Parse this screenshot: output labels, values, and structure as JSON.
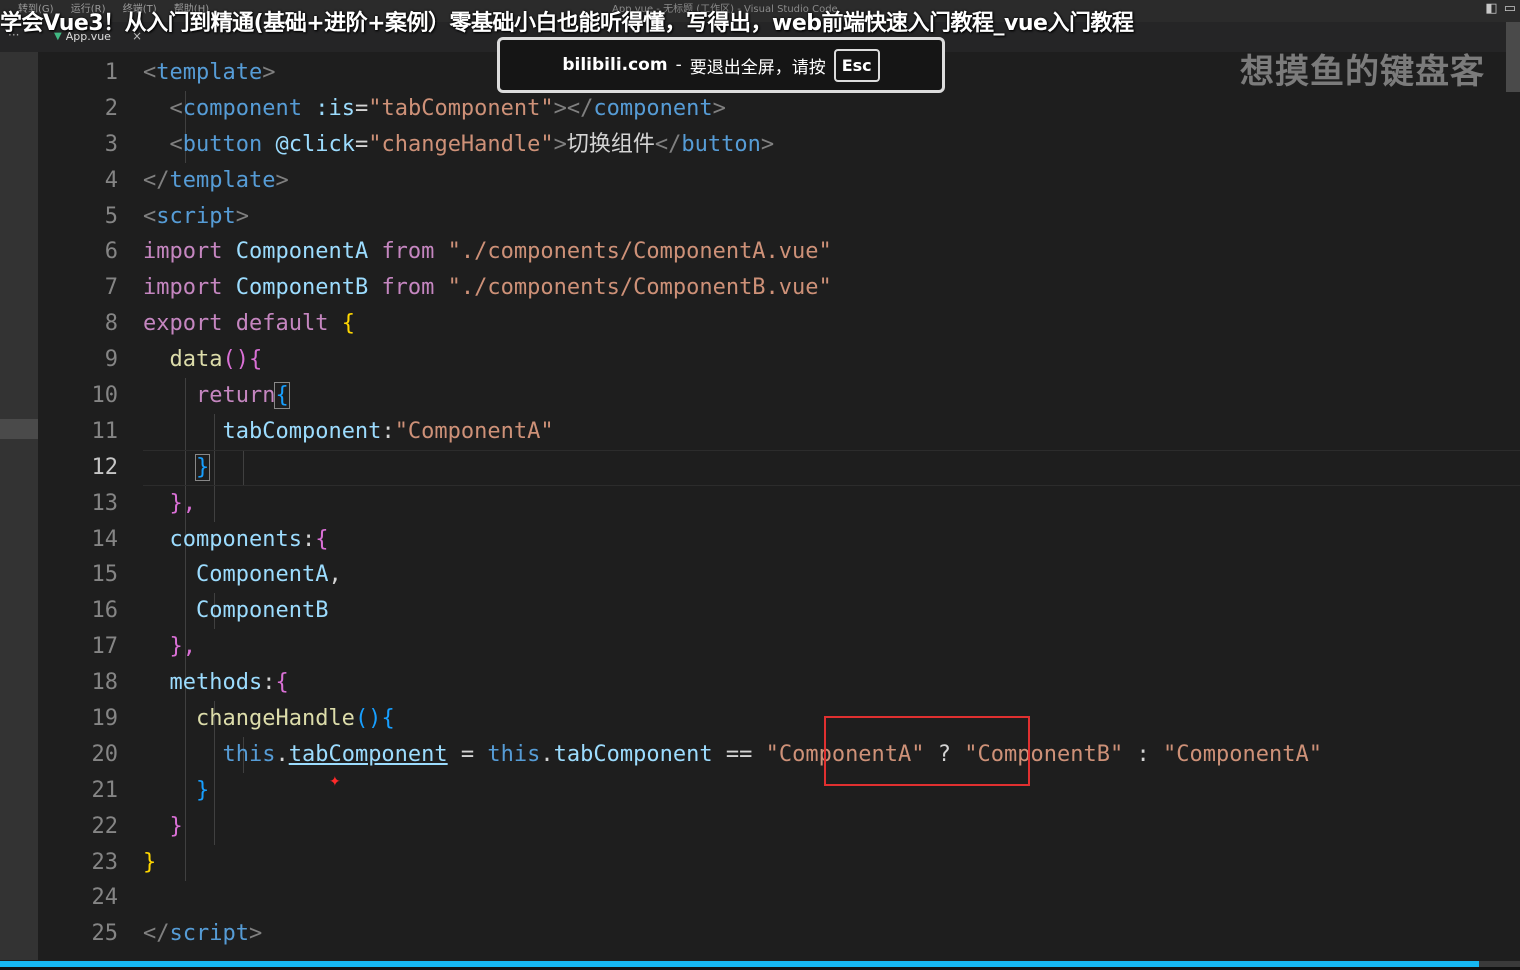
{
  "menu": [
    "转到(G)",
    "运行(R)",
    "终端(T)",
    "帮助(H)"
  ],
  "window_title": "App.vue - 无标题 (工作区) - Visual Studio Code",
  "video_title": "学会Vue3！从入门到精通(基础+进阶+案例）零基础小白也能听得懂，写得出，web前端快速入门教程_vue入门教程",
  "tab": {
    "ellipsis": "···",
    "label": "App.vue",
    "close": "×"
  },
  "fullscreen_notice": {
    "domain": "bilibili.com",
    "dash": "-",
    "message": "要退出全屏，请按",
    "key": "Esc"
  },
  "watermark": "想摸鱼的键盘客",
  "editor": {
    "active_line": 12,
    "lines": [
      {
        "n": "1"
      },
      {
        "n": "2"
      },
      {
        "n": "3"
      },
      {
        "n": "4"
      },
      {
        "n": "5"
      },
      {
        "n": "6"
      },
      {
        "n": "7"
      },
      {
        "n": "8"
      },
      {
        "n": "9"
      },
      {
        "n": "10"
      },
      {
        "n": "11"
      },
      {
        "n": "12"
      },
      {
        "n": "13"
      },
      {
        "n": "14"
      },
      {
        "n": "15"
      },
      {
        "n": "16"
      },
      {
        "n": "17"
      },
      {
        "n": "18"
      },
      {
        "n": "19"
      },
      {
        "n": "20"
      },
      {
        "n": "21"
      },
      {
        "n": "22"
      },
      {
        "n": "23"
      },
      {
        "n": "24"
      },
      {
        "n": "25"
      }
    ],
    "tokens": {
      "lt": "<",
      "gt": ">",
      "lt_slash": "</",
      "gt_lt_slash": "></",
      "template": "template",
      "component": "component",
      "button": "button",
      "script": "script",
      "is_attr": ":is",
      "click_attr": "@click",
      "eq": "=",
      "tabComponent_q": "\"tabComponent\"",
      "changeHandle_q": "\"changeHandle\"",
      "button_text": "切换组件",
      "import": "import",
      "from": "from",
      "export": "export",
      "default": "default",
      "ComponentA": "ComponentA",
      "ComponentB": "ComponentB",
      "pathA": "\"./components/ComponentA.vue\"",
      "pathB": "\"./components/ComponentB.vue\"",
      "data": "data",
      "paren": "()",
      "brace_open": "{",
      "brace_close": "}",
      "return": "return",
      "tabComponent": "tabComponent",
      "colon": ":",
      "strA": "\"ComponentA\"",
      "strB": "\"ComponentB\"",
      "close_comma": "},",
      "components": "components",
      "comma": ",",
      "methods": "methods",
      "changeHandle": "changeHandle",
      "this": "this",
      "dot": ".",
      "assign": " = ",
      "eqeq": " == ",
      "question": " ? ",
      "colon_sp": " : "
    }
  },
  "video_progress": 0.973
}
